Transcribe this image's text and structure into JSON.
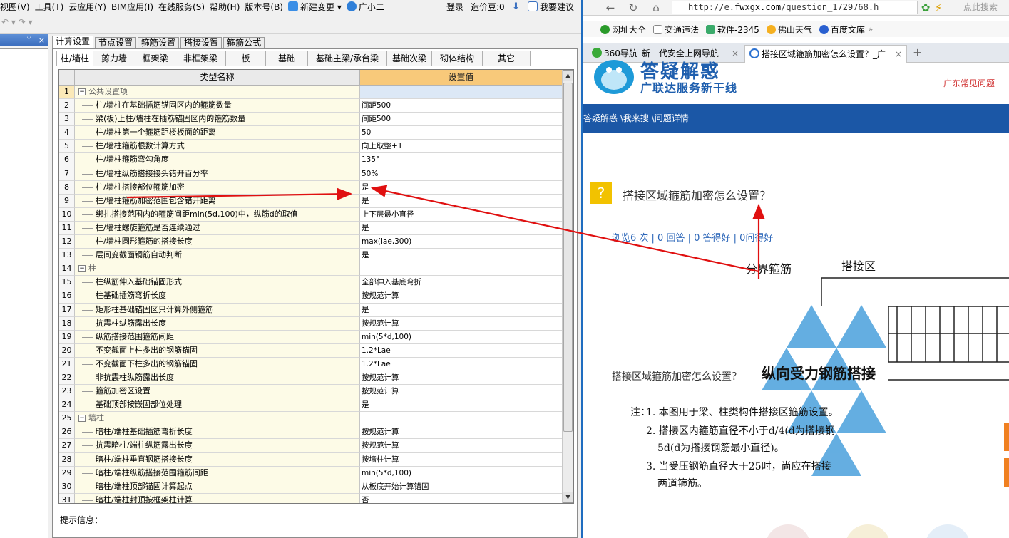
{
  "app": {
    "menus": [
      "视图(V)",
      "工具(T)",
      "云应用(Y)",
      "BIM应用(I)",
      "在线服务(S)",
      "帮助(H)",
      "版本号(B)"
    ],
    "new_change": "新建变更",
    "assistant": "广小二",
    "login": "登录",
    "price_beans": "造价豆:0",
    "suggest": "我要建议",
    "panel_pin": "ᛘ",
    "panel_close": "×",
    "main_tabs": [
      "计算设置",
      "节点设置",
      "箍筋设置",
      "搭接设置",
      "箍筋公式"
    ],
    "sub_tabs": [
      "柱/墙柱",
      "剪力墙",
      "框架梁",
      "非框架梁",
      "板",
      "基础",
      "基础主梁/承台梁",
      "基础次梁",
      "砌体结构",
      "其它"
    ],
    "grid": {
      "col_name": "类型名称",
      "col_value": "设置值",
      "rows": [
        {
          "n": "1",
          "name": "公共设置项",
          "value": "",
          "group": true
        },
        {
          "n": "2",
          "name": "柱/墙柱在基础插筋锚固区内的箍筋数量",
          "value": "间距500"
        },
        {
          "n": "3",
          "name": "梁(板)上柱/墙柱在插筋锚固区内的箍筋数量",
          "value": "间距500"
        },
        {
          "n": "4",
          "name": "柱/墙柱第一个箍筋距楼板面的距离",
          "value": "50"
        },
        {
          "n": "5",
          "name": "柱/墙柱箍筋根数计算方式",
          "value": "向上取整+1"
        },
        {
          "n": "6",
          "name": "柱/墙柱箍筋弯勾角度",
          "value": "135°"
        },
        {
          "n": "7",
          "name": "柱/墙柱纵筋搭接接头错开百分率",
          "value": "50%"
        },
        {
          "n": "8",
          "name": "柱/墙柱搭接部位箍筋加密",
          "value": "是"
        },
        {
          "n": "9",
          "name": "柱/墙柱箍筋加密范围包含错开距离",
          "value": "是"
        },
        {
          "n": "10",
          "name": "绑扎搭接范围内的箍筋间距min(5d,100)中，纵筋d的取值",
          "value": "上下层最小直径"
        },
        {
          "n": "11",
          "name": "柱/墙柱螺旋箍筋是否连续通过",
          "value": "是"
        },
        {
          "n": "12",
          "name": "柱/墙柱圆形箍筋的搭接长度",
          "value": "max(lae,300)"
        },
        {
          "n": "13",
          "name": "层间变截面钢筋自动判断",
          "value": "是"
        },
        {
          "n": "14",
          "name": "柱",
          "value": "",
          "group": true
        },
        {
          "n": "15",
          "name": "柱纵筋伸入基础锚固形式",
          "value": "全部伸入基底弯折"
        },
        {
          "n": "16",
          "name": "柱基础插筋弯折长度",
          "value": "按规范计算"
        },
        {
          "n": "17",
          "name": "矩形柱基础锚固区只计算外侧箍筋",
          "value": "是"
        },
        {
          "n": "18",
          "name": "抗震柱纵筋露出长度",
          "value": "按规范计算"
        },
        {
          "n": "19",
          "name": "纵筋搭接范围箍筋间距",
          "value": "min(5*d,100)"
        },
        {
          "n": "20",
          "name": "不变截面上柱多出的钢筋锚固",
          "value": "1.2*Lae"
        },
        {
          "n": "21",
          "name": "不变截面下柱多出的钢筋锚固",
          "value": "1.2*Lae"
        },
        {
          "n": "22",
          "name": "非抗震柱纵筋露出长度",
          "value": "按规范计算"
        },
        {
          "n": "23",
          "name": "箍筋加密区设置",
          "value": "按规范计算"
        },
        {
          "n": "24",
          "name": "基础顶部按嵌固部位处理",
          "value": "是"
        },
        {
          "n": "25",
          "name": "墙柱",
          "value": "",
          "group": true
        },
        {
          "n": "26",
          "name": "暗柱/端柱基础插筋弯折长度",
          "value": "按规范计算"
        },
        {
          "n": "27",
          "name": "抗震暗柱/端柱纵筋露出长度",
          "value": "按规范计算"
        },
        {
          "n": "28",
          "name": "暗柱/端柱垂直钢筋搭接长度",
          "value": "按墙柱计算"
        },
        {
          "n": "29",
          "name": "暗柱/端柱纵筋搭接范围箍筋间距",
          "value": "min(5*d,100)"
        },
        {
          "n": "30",
          "name": "暗柱/端柱顶部锚固计算起点",
          "value": "从板底开始计算锚固"
        },
        {
          "n": "31",
          "name": "暗柱/端柱封顶按框架柱计算",
          "value": "否"
        }
      ]
    },
    "hint_label": "提示信息："
  },
  "browser": {
    "url_prefix": "http://e.",
    "url_host": "fwxgx.com",
    "url_path": "/question_1729768.h",
    "search_placeholder": "点此搜索",
    "favorites": [
      "网址大全",
      "交通违法",
      "软件-2345",
      "佛山天气",
      "百度文库"
    ],
    "tabs": [
      {
        "title": "360导航_新一代安全上网导航",
        "active": false
      },
      {
        "title": "搭接区域箍筋加密怎么设置？_广",
        "active": true
      }
    ],
    "page": {
      "logo_title": "答疑解惑",
      "logo_sub": "广联达服务新干线",
      "region_link": "广东常见问题",
      "breadcrumb": "答疑解惑 \\我来搜 \\问题详情",
      "question_mark": "?",
      "question_title": "搭接区域箍筋加密怎么设置？",
      "stats": "浏览6 次 | 0 回答 | 0 答得好 | 0问得好",
      "body_text": "搭接区域箍筋加密怎么设置？",
      "figure": {
        "label_boundary": "分界箍筋",
        "label_lap": "搭接区",
        "caption": "纵向受力钢筋搭接",
        "note_prefix": "注：",
        "notes": [
          "1. 本图用于梁、柱类构件搭接区箍筋设置。",
          "2. 搭接区内箍筋直径不小于d/4(d为搭接钢",
          "5d(d为搭接钢筋最小直径)。",
          "3. 当受压钢筋直径大于25时，尚应在搭接",
          "两道箍筋。"
        ]
      }
    }
  },
  "colors": {
    "value_header": "#f8c97a",
    "name_cell": "#fdfbe7",
    "blue_bar": "#1b57a6",
    "arrow": "#e01010",
    "question_icon": "#f2c200"
  }
}
